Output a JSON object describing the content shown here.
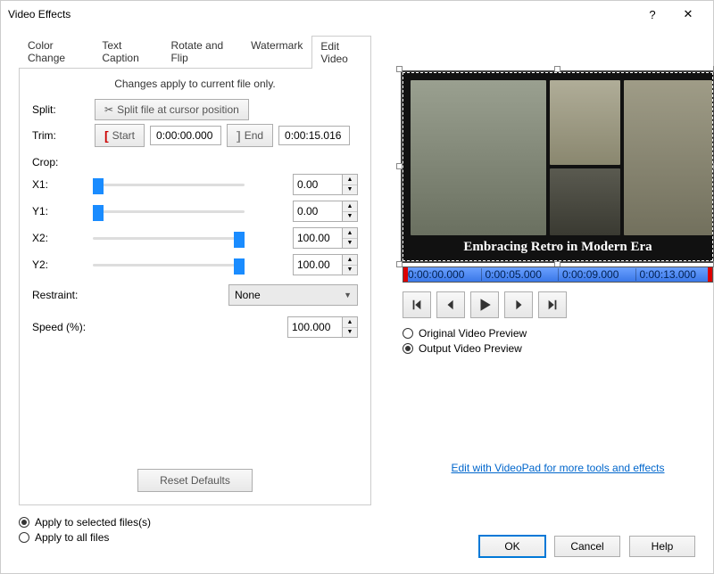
{
  "window": {
    "title": "Video Effects"
  },
  "tabs": {
    "color_change": "Color Change",
    "text_caption": "Text Caption",
    "rotate_flip": "Rotate and Flip",
    "watermark": "Watermark",
    "edit_video": "Edit Video"
  },
  "panel": {
    "note": "Changes apply to current file only.",
    "split_label": "Split:",
    "split_button": "Split file at cursor position",
    "trim_label": "Trim:",
    "trim_start_btn": "Start",
    "trim_start_time": "0:00:00.000",
    "trim_end_btn": "End",
    "trim_end_time": "0:00:15.016",
    "crop_label": "Crop:",
    "x1_label": "X1:",
    "x1_value": "0.00",
    "y1_label": "Y1:",
    "y1_value": "0.00",
    "x2_label": "X2:",
    "x2_value": "100.00",
    "y2_label": "Y2:",
    "y2_value": "100.00",
    "restraint_label": "Restraint:",
    "restraint_value": "None",
    "speed_label": "Speed (%):",
    "speed_value": "100.000",
    "reset_btn": "Reset Defaults"
  },
  "apply": {
    "selected": "Apply to selected files(s)",
    "all": "Apply to all files"
  },
  "preview": {
    "caption": "Embracing Retro in Modern Era",
    "timeline": [
      "0:00:00.000",
      "0:00:05.000",
      "0:00:09.000",
      "0:00:13.000"
    ],
    "original_label": "Original Video Preview",
    "output_label": "Output Video Preview",
    "link": "Edit with VideoPad for more tools and effects"
  },
  "buttons": {
    "ok": "OK",
    "cancel": "Cancel",
    "help": "Help"
  }
}
